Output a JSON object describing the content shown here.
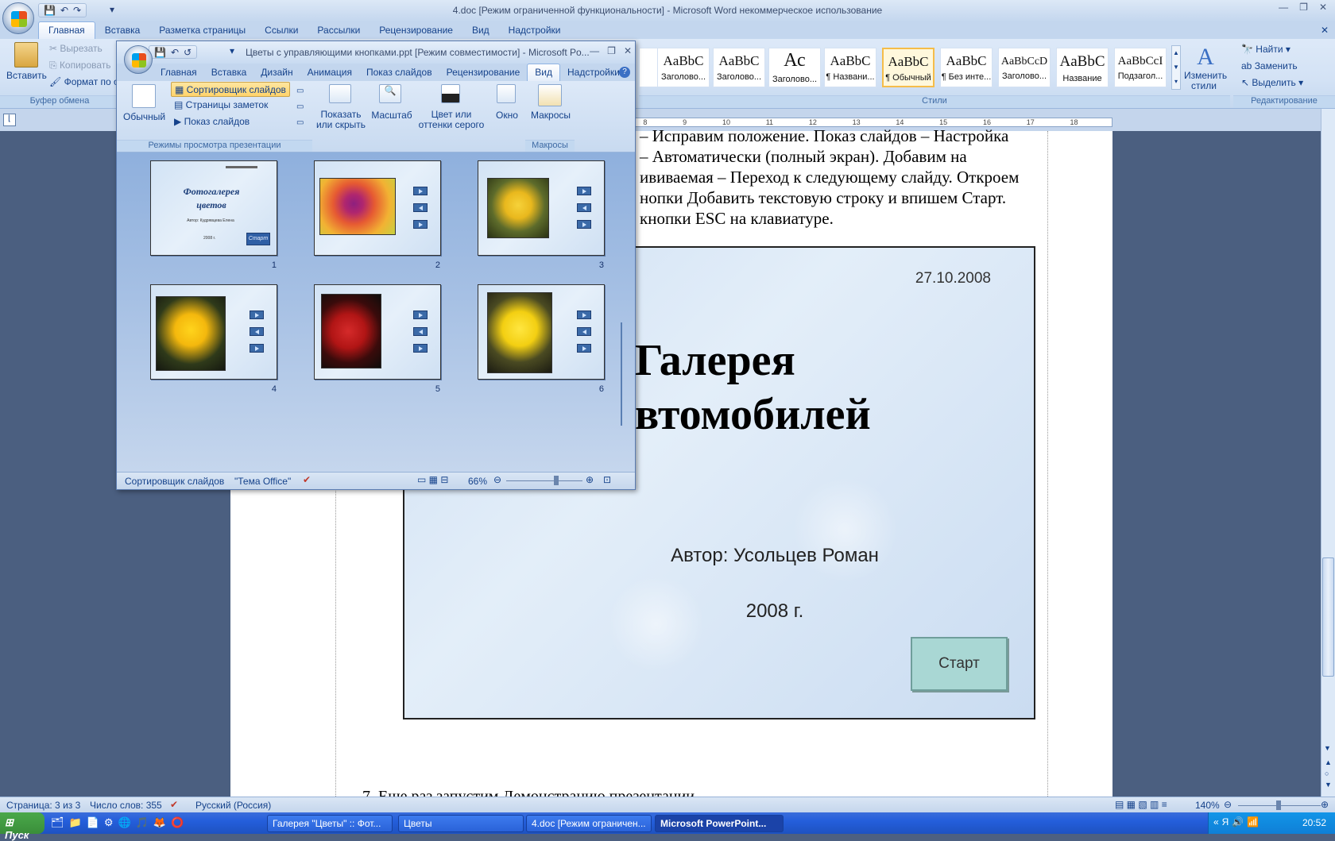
{
  "word": {
    "title": "4.doc [Режим ограниченной функциональности] - Microsoft Word некоммерческое использование",
    "tabs": [
      "Главная",
      "Вставка",
      "Разметка страницы",
      "Ссылки",
      "Рассылки",
      "Рецензирование",
      "Вид",
      "Надстройки"
    ],
    "clipboard": {
      "paste": "Вставить",
      "cut": "Вырезать",
      "copy": "Копировать",
      "format": "Формат по о",
      "group": "Буфер обмена"
    },
    "styles": {
      "group": "Стили",
      "tiles": [
        {
          "sample": "оС",
          "name": "о..."
        },
        {
          "sample": "AaBbC",
          "name": "Заголово..."
        },
        {
          "sample": "AaBbC",
          "name": "Заголово..."
        },
        {
          "sample": "Ас",
          "name": "Заголово..."
        },
        {
          "sample": "AaBbC",
          "name": "¶ Названи..."
        },
        {
          "sample": "AaBbC",
          "name": "¶ Обычный"
        },
        {
          "sample": "AaBbC",
          "name": "¶ Без инте..."
        },
        {
          "sample": "AaBbCcD",
          "name": "Заголово..."
        },
        {
          "sample": "AaBbC",
          "name": "Название"
        },
        {
          "sample": "AaBbCcI",
          "name": "Подзагол..."
        }
      ],
      "change": "Изменить стили"
    },
    "editing": {
      "find": "Найти",
      "replace": "Заменить",
      "select": "Выделить",
      "group": "Редактирование"
    },
    "ruler_numbers": [
      "8",
      "9",
      "10",
      "11",
      "12",
      "13",
      "14",
      "15",
      "16",
      "17",
      "18"
    ],
    "doc_lines": [
      "– Исправим положение. Показ слайдов – Настройка",
      "– Автоматически (полный экран). Добавим на",
      "ививаемая – Переход к следующему слайду. Откроем",
      "нопки Добавить текстовую строку и впишем Старт.",
      "кнопки ESC на клавиатуре."
    ],
    "bottom_line": "7.   Еще раз запустим Демонстрацию презентации",
    "slide": {
      "date": "27.10.2008",
      "title_line1": "Галерея",
      "title_line2": "втомобилей",
      "author": "Автор: Усольцев Роман",
      "year": "2008 г.",
      "start": "Старт"
    },
    "status": {
      "page": "Страница: 3 из 3",
      "words": "Число слов: 355",
      "lang": "Русский (Россия)",
      "zoom": "140%"
    }
  },
  "ppt": {
    "title": "Цветы с управляющими кнопками.ppt [Режим совместимости] - Microsoft Po...",
    "tabs": [
      "Главная",
      "Вставка",
      "Дизайн",
      "Анимация",
      "Показ слайдов",
      "Рецензирование",
      "Вид",
      "Надстройки"
    ],
    "ribbon": {
      "normal": "Обычный",
      "sorter": "Сортировщик слайдов",
      "notes": "Страницы заметок",
      "show": "Показ слайдов",
      "group_views": "Режимы просмотра презентации",
      "show_hide": "Показать или скрыть",
      "zoom": "Масштаб",
      "color": "Цвет или оттенки серого",
      "window": "Окно",
      "macros": "Макросы",
      "group_macros": "Макросы"
    },
    "slides": [
      {
        "num": "1",
        "title": "Фотогалерея цветов",
        "author": "Автор: Кудрявцева Елена",
        "year": "2008 г.",
        "start": "Старт"
      },
      {
        "num": "2"
      },
      {
        "num": "3"
      },
      {
        "num": "4"
      },
      {
        "num": "5"
      },
      {
        "num": "6"
      }
    ],
    "status": {
      "view": "Сортировщик слайдов",
      "theme": "\"Тема Office\"",
      "zoom": "66%"
    }
  },
  "taskbar": {
    "start": "Пуск",
    "buttons": [
      "Галерея \"Цветы\" :: Фот...",
      "Цветы",
      "4.doc [Режим ограничен...",
      "Microsoft PowerPoint..."
    ],
    "clock": "20:52"
  }
}
